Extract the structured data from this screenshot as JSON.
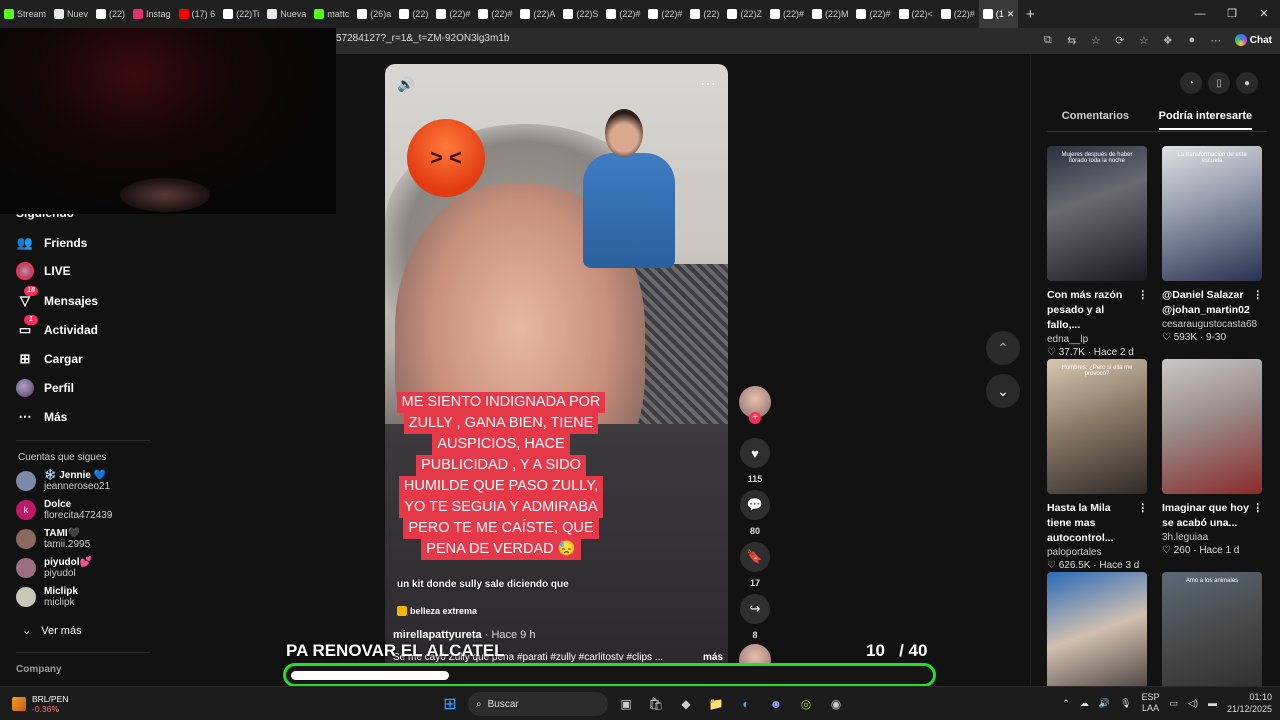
{
  "browser": {
    "tabs": [
      {
        "label": "Stream",
        "icon": "kick-icon",
        "color": "#53fc18"
      },
      {
        "label": "Nuev",
        "icon": "page-icon",
        "color": "#e8e8e8"
      },
      {
        "label": "(22)",
        "icon": "tiktok-icon",
        "color": "#ffffff"
      },
      {
        "label": "Instag",
        "icon": "instagram-icon",
        "color": "#e1306c"
      },
      {
        "label": "(17) 6",
        "icon": "youtube-icon",
        "color": "#ff0000"
      },
      {
        "label": "(22)Ti",
        "icon": "tiktok-icon",
        "color": "#ffffff"
      },
      {
        "label": "Nueva",
        "icon": "page-icon",
        "color": "#e8e8e8"
      },
      {
        "label": "mattc",
        "icon": "kick-icon",
        "color": "#53fc18"
      },
      {
        "label": "(26)a",
        "icon": "tiktok-icon",
        "color": "#ffffff"
      },
      {
        "label": "(22)",
        "icon": "tiktok-icon",
        "color": "#ffffff"
      },
      {
        "label": "(22)#",
        "icon": "tiktok-icon",
        "color": "#ffffff"
      },
      {
        "label": "(22)#",
        "icon": "tiktok-icon",
        "color": "#ffffff"
      },
      {
        "label": "(22)A",
        "icon": "tiktok-icon",
        "color": "#ffffff"
      },
      {
        "label": "(22)S",
        "icon": "tiktok-icon",
        "color": "#ffffff"
      },
      {
        "label": "(22)#",
        "icon": "tiktok-icon",
        "color": "#ffffff"
      },
      {
        "label": "(22)#",
        "icon": "tiktok-icon",
        "color": "#ffffff"
      },
      {
        "label": "(22)",
        "icon": "tiktok-icon",
        "color": "#ffffff"
      },
      {
        "label": "(22)Z",
        "icon": "tiktok-icon",
        "color": "#ffffff"
      },
      {
        "label": "(22)#",
        "icon": "tiktok-icon",
        "color": "#ffffff"
      },
      {
        "label": "(22)M",
        "icon": "tiktok-icon",
        "color": "#ffffff"
      },
      {
        "label": "(22)#",
        "icon": "tiktok-icon",
        "color": "#ffffff"
      },
      {
        "label": "(22)<",
        "icon": "tiktok-icon",
        "color": "#ffffff"
      },
      {
        "label": "(22)#",
        "icon": "tiktok-icon",
        "color": "#ffffff"
      },
      {
        "label": "(1",
        "icon": "tiktok-icon",
        "color": "#ffffff",
        "active": true
      }
    ],
    "url": "57284127?_r=1&_t=ZM-92ON3lg3m1b",
    "chat_label": "Chat"
  },
  "sidebar": {
    "partial_label": "Siguiendo",
    "items": [
      {
        "label": "Friends",
        "icon": "friends-icon"
      },
      {
        "label": "LIVE",
        "icon": "live-avatar-icon"
      },
      {
        "label": "Mensajes",
        "icon": "messages-icon",
        "badge": "18"
      },
      {
        "label": "Actividad",
        "icon": "activity-icon",
        "badge": "1"
      },
      {
        "label": "Cargar",
        "icon": "upload-icon"
      },
      {
        "label": "Perfil",
        "icon": "profile-avatar-icon"
      },
      {
        "label": "Más",
        "icon": "more-icon"
      }
    ],
    "following_title": "Cuentas que sigues",
    "accounts": [
      {
        "name": "❄️ Jennie 💙",
        "handle": "jeanneroseo21",
        "color": "#7a8aa8"
      },
      {
        "name": "Dolce",
        "handle": "florecita472439",
        "color": "#c0186a",
        "initial": "k"
      },
      {
        "name": "TAMI🖤",
        "handle": "tamii.2995",
        "color": "#8a6a60"
      },
      {
        "name": "piyudol💕",
        "handle": "piyudol",
        "color": "#9a7080"
      },
      {
        "name": "Miclipk",
        "handle": "miclipk",
        "color": "#c8c8b8"
      }
    ],
    "see_more": "Ver más",
    "company": "Company"
  },
  "video": {
    "caption_lines": [
      "ME SIENTO INDIGNADA  POR",
      "ZULLY , GANA BIEN, TIENE",
      "AUSPICIOS,  HACE",
      "PUBLICIDAD , Y A SIDO",
      "HUMILDE  QUE PASO ZULLY,",
      "YO TE SEGUIA Y ADMIRABA",
      "PERO TE ME CAÍSTE,  QUE",
      "PENA DE VERDAD 😓"
    ],
    "inline_subtitle": "un kit donde sully sale diciendo que",
    "tag": "belleza extrema",
    "author": "mirellapattyureta",
    "time": "· Hace 9 h",
    "description": "Se me cayó Zully qué pena #parati #zully #carlitostv #clips ...",
    "more": "más"
  },
  "actions": {
    "likes": "115",
    "comments": "80",
    "saves": "17",
    "shares": "8"
  },
  "right_panel": {
    "tabs": [
      "Comentarios",
      "Podría interesarte"
    ],
    "active_tab": 1,
    "cards": [
      {
        "title": "Con más razón pesado y al fallo,...",
        "user": "edna__lp",
        "likes": "37.7K",
        "age": "Hace 2 d",
        "overlay": "Mujeres después de haber llorado toda la noche",
        "bg": "linear-gradient(160deg,#2a3040,#6a6a70 40%,#1a1a20)"
      },
      {
        "title": "@Daniel Salazar @johan_martin02",
        "user": "cesaraugustocasta68",
        "likes": "593K",
        "age": "9-30",
        "overlay": "La transformación de esta escuela",
        "bg": "linear-gradient(160deg,#e0e0e0,#9aa0b0 40%,#2a3050)"
      },
      {
        "title": "Hasta la Mila tiene mas autocontrol...",
        "user": "paloportales",
        "likes": "626.5K",
        "age": "Hace 3 d",
        "overlay": "Hombres: ¿Pero si ella me provocó?",
        "bg": "linear-gradient(160deg,#d8c8b0,#8a7a68 45%,#302a28)"
      },
      {
        "title": "Imaginar que hoy se acabó una...",
        "user": "3h.leguiaa",
        "likes": "260",
        "age": "Hace 1 d",
        "overlay": "",
        "bg": "linear-gradient(160deg,#c8c8c8,#9a8a8a 45%,#8a2a2a)"
      },
      {
        "title": "",
        "user": "",
        "likes": "",
        "age": "",
        "overlay": "",
        "bg": "linear-gradient(160deg,#2a6ab8,#d0c0b0 45%,#302a28)"
      },
      {
        "title": "",
        "user": "",
        "likes": "",
        "age": "",
        "overlay": "Amo a los animales",
        "bg": "linear-gradient(160deg,#5a6a7a,#4a4a4a 45%,#2a2a2a)"
      }
    ]
  },
  "overlay": {
    "banner": "PA RENOVAR EL ALCATEL",
    "counter_current": "10",
    "counter_total": "/ 40",
    "progress": 0.25,
    "progress_color": "#22e02a"
  },
  "taskbar": {
    "stock_name": "BRL/PEN",
    "stock_change": "-0.36%",
    "search_placeholder": "Buscar",
    "lang_1": "ESP",
    "lang_2": "LAA",
    "time": "01:10",
    "date": "21/12/2025"
  }
}
